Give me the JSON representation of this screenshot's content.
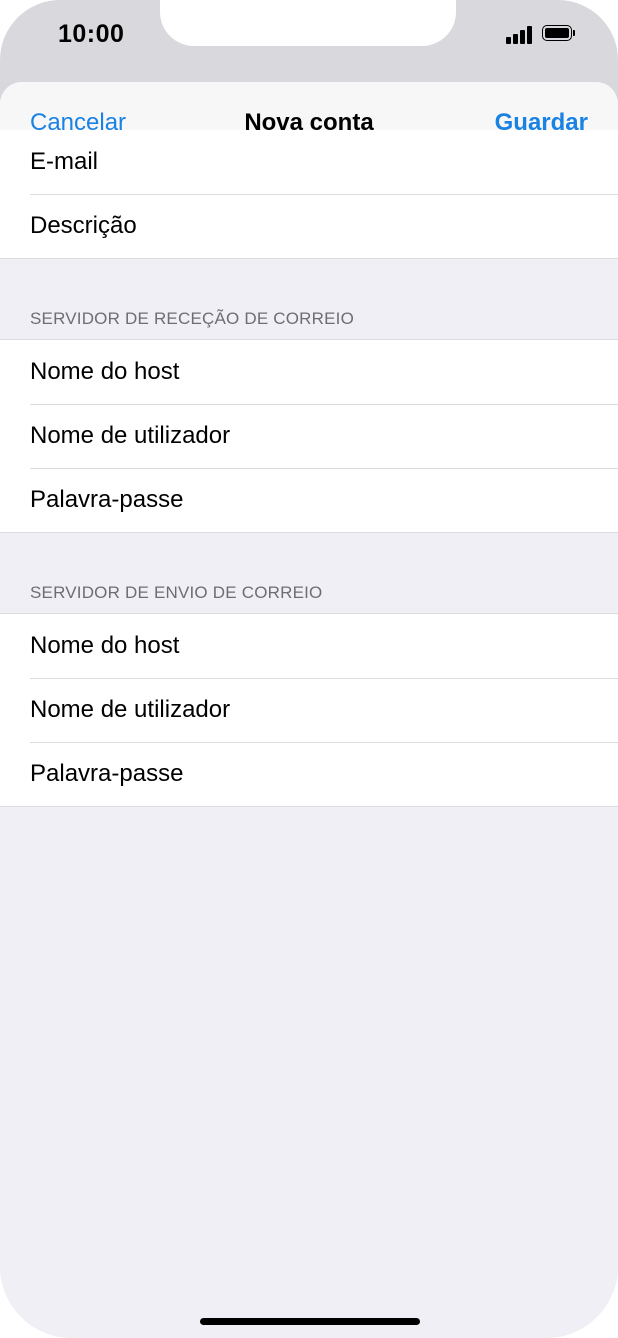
{
  "status_bar": {
    "time": "10:00"
  },
  "nav": {
    "cancel_label": "Cancelar",
    "title": "Nova conta",
    "save_label": "Guardar"
  },
  "account": {
    "rows": [
      {
        "label": "E-mail"
      },
      {
        "label": "Descrição"
      }
    ]
  },
  "incoming": {
    "header": "SERVIDOR DE RECEÇÃO DE CORREIO",
    "rows": [
      {
        "label": "Nome do host"
      },
      {
        "label": "Nome de utilizador"
      },
      {
        "label": "Palavra-passe"
      }
    ]
  },
  "outgoing": {
    "header": "SERVIDOR DE ENVIO DE CORREIO",
    "rows": [
      {
        "label": "Nome do host"
      },
      {
        "label": "Nome de utilizador"
      },
      {
        "label": "Palavra-passe"
      }
    ]
  },
  "colors": {
    "accent": "#1a82e2",
    "background": "#f0eff5"
  }
}
